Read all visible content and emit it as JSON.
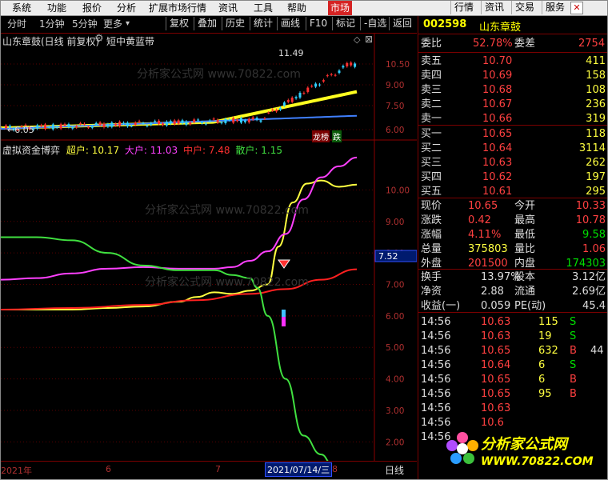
{
  "menu": {
    "items": [
      "系统",
      "功能",
      "报价",
      "分析",
      "扩展市场行情",
      "资讯",
      "工具",
      "帮助",
      "市场"
    ],
    "active_item": "市场",
    "right_buttons": [
      "行情",
      "资讯",
      "交易",
      "服务"
    ],
    "close_glyph": "✕"
  },
  "toolbar": {
    "periods": [
      "分时",
      "1分钟",
      "5分钟",
      "更多"
    ],
    "more_arrow": "▾",
    "buttons": [
      "复权",
      "叠加",
      "历史",
      "统计",
      "画线",
      "F10",
      "标记",
      "-自选",
      "返回"
    ]
  },
  "chart_header": {
    "stock_title": "山东章鼓(日线 前复权)",
    "indicator_name": "短中黄蓝带",
    "peak_label": "11.49",
    "low_label": "6.05",
    "badge_longhu": "龙榜",
    "badge_die": "跌"
  },
  "upper_axis": [
    "10.50",
    "9.00",
    "7.50",
    "6.00"
  ],
  "lower_axis": [
    "10.00",
    "9.00",
    "8.00",
    "7.00",
    "6.00",
    "5.00",
    "4.00",
    "3.00",
    "2.00"
  ],
  "lower_header": {
    "title": "虚拟资金博弈",
    "super_label": "超户:",
    "super_value": "10.17",
    "big_label": "大户:",
    "big_value": "11.03",
    "mid_label": "中户:",
    "mid_value": "7.48",
    "small_label": "散户:",
    "small_value": "1.15"
  },
  "cursor_value": "7.52",
  "watermark_text": "分析家公式网 www.70822.com",
  "bottom_axis": {
    "year_label": "2021年",
    "months": [
      "6",
      "7",
      "8"
    ],
    "cursor_date": "2021/07/14/三",
    "period_button": "日线"
  },
  "quote": {
    "code": "002598",
    "name": "山东章鼓",
    "weibi_label": "委比",
    "weibi_value": "52.78%",
    "weicha_label": "委差",
    "weicha_value": "2754",
    "asks": [
      {
        "label": "卖五",
        "price": "10.70",
        "vol": "411"
      },
      {
        "label": "卖四",
        "price": "10.69",
        "vol": "158"
      },
      {
        "label": "卖三",
        "price": "10.68",
        "vol": "108"
      },
      {
        "label": "卖二",
        "price": "10.67",
        "vol": "236"
      },
      {
        "label": "卖一",
        "price": "10.66",
        "vol": "319"
      }
    ],
    "bids": [
      {
        "label": "买一",
        "price": "10.65",
        "vol": "118"
      },
      {
        "label": "买二",
        "price": "10.64",
        "vol": "3114"
      },
      {
        "label": "买三",
        "price": "10.63",
        "vol": "262"
      },
      {
        "label": "买四",
        "price": "10.62",
        "vol": "197"
      },
      {
        "label": "买五",
        "price": "10.61",
        "vol": "295"
      }
    ],
    "stats": [
      {
        "l1": "现价",
        "v1": "10.65",
        "c1": "red",
        "l2": "今开",
        "v2": "10.33",
        "c2": "red"
      },
      {
        "l1": "涨跌",
        "v1": "0.42",
        "c1": "red",
        "l2": "最高",
        "v2": "10.78",
        "c2": "red"
      },
      {
        "l1": "涨幅",
        "v1": "4.11%",
        "c1": "red",
        "l2": "最低",
        "v2": "9.58",
        "c2": "green"
      },
      {
        "l1": "总量",
        "v1": "375803",
        "c1": "yellow",
        "l2": "量比",
        "v2": "1.06",
        "c2": "red"
      },
      {
        "l1": "外盘",
        "v1": "201500",
        "c1": "red",
        "l2": "内盘",
        "v2": "174303",
        "c2": "green"
      }
    ],
    "fundamentals": [
      {
        "l1": "换手",
        "v1": "13.97%",
        "l2": "股本",
        "v2": "3.12亿"
      },
      {
        "l1": "净资",
        "v1": "2.88",
        "l2": "流通",
        "v2": "2.69亿"
      },
      {
        "l1": "收益(一)",
        "v1": "0.059",
        "l2": "PE(动)",
        "v2": "45.4"
      }
    ],
    "ticks": [
      {
        "time": "14:56",
        "price": "10.63",
        "vol": "115",
        "side": "S"
      },
      {
        "time": "14:56",
        "price": "10.63",
        "vol": "19",
        "side": "S"
      },
      {
        "time": "14:56",
        "price": "10.65",
        "vol": "632",
        "side": "B",
        "extra": "44"
      },
      {
        "time": "14:56",
        "price": "10.64",
        "vol": "6",
        "side": "S"
      },
      {
        "time": "14:56",
        "price": "10.65",
        "vol": "6",
        "side": "B"
      },
      {
        "time": "14:56",
        "price": "10.65",
        "vol": "95",
        "side": "B"
      },
      {
        "time": "14:56",
        "price": "10.63",
        "vol": "",
        "side": ""
      },
      {
        "time": "14:56",
        "price": "10.6",
        "vol": "",
        "side": ""
      },
      {
        "time": "14:56",
        "price": "",
        "vol": "",
        "side": ""
      }
    ]
  },
  "logo": {
    "text": "分析家公式网",
    "url": "WWW.70822.COM"
  },
  "colors": {
    "super": "#ffff40",
    "big": "#ff40ff",
    "mid": "#ff2020",
    "small": "#40e040",
    "grid": "#8b0000"
  },
  "chart_data": [
    {
      "type": "line",
      "title": "虚拟资金博弈",
      "ylim": [
        1.5,
        10.9
      ],
      "series": [
        {
          "name": "超户",
          "color": "#ffff40",
          "x": [
            0,
            0.1,
            0.2,
            0.3,
            0.4,
            0.5,
            0.55,
            0.6,
            0.65,
            0.7,
            0.75,
            0.78,
            0.82,
            0.86,
            0.9,
            0.95,
            1.0
          ],
          "values": [
            6.2,
            6.2,
            6.2,
            6.25,
            6.3,
            6.45,
            6.6,
            6.75,
            6.7,
            6.8,
            7.0,
            8.2,
            9.6,
            10.2,
            10.3,
            10.1,
            10.17
          ]
        },
        {
          "name": "大户",
          "color": "#ff40ff",
          "x": [
            0,
            0.1,
            0.2,
            0.3,
            0.4,
            0.5,
            0.6,
            0.65,
            0.7,
            0.75,
            0.8,
            0.85,
            0.9,
            0.95,
            1.0
          ],
          "values": [
            7.15,
            7.2,
            7.35,
            7.5,
            7.55,
            7.5,
            7.5,
            7.55,
            7.75,
            8.05,
            8.6,
            9.7,
            10.4,
            10.75,
            11.03
          ]
        },
        {
          "name": "中户",
          "color": "#ff2020",
          "x": [
            0,
            0.2,
            0.4,
            0.55,
            0.7,
            0.8,
            0.9,
            1.0
          ],
          "values": [
            6.2,
            6.25,
            6.35,
            6.5,
            6.7,
            6.85,
            7.15,
            7.48
          ]
        },
        {
          "name": "散户",
          "color": "#40e040",
          "x": [
            0,
            0.1,
            0.2,
            0.3,
            0.4,
            0.5,
            0.6,
            0.65,
            0.7,
            0.72,
            0.75,
            0.8,
            0.85,
            0.9,
            0.93,
            0.96,
            1.0
          ],
          "values": [
            8.5,
            8.5,
            8.4,
            8.0,
            7.6,
            7.45,
            7.45,
            7.3,
            7.2,
            6.9,
            6.0,
            4.0,
            2.2,
            1.6,
            1.3,
            1.2,
            1.15
          ]
        }
      ]
    }
  ]
}
